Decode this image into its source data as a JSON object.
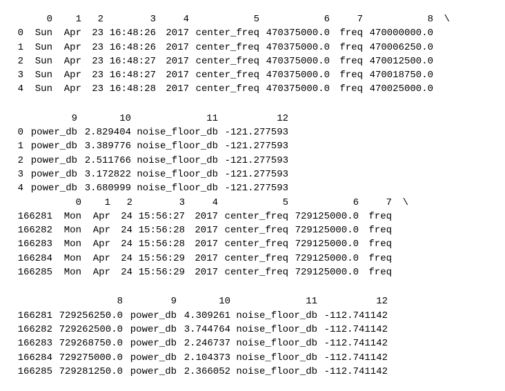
{
  "backslash": "\\",
  "headerA": {
    "idx": "",
    "c0": "0",
    "c1": "1",
    "c2": "2",
    "c3": "3",
    "c4": "4",
    "c5": "5",
    "c6": "6",
    "c7": "7",
    "c8": "8"
  },
  "blockA": [
    {
      "idx": "0",
      "c0": "Sun",
      "c1": "Apr",
      "c2": "23",
      "c3": "16:48:26",
      "c4": "2017",
      "c5": "center_freq",
      "c6": "470375000.0",
      "c7": "freq",
      "c8": "470000000.0"
    },
    {
      "idx": "1",
      "c0": "Sun",
      "c1": "Apr",
      "c2": "23",
      "c3": "16:48:26",
      "c4": "2017",
      "c5": "center_freq",
      "c6": "470375000.0",
      "c7": "freq",
      "c8": "470006250.0"
    },
    {
      "idx": "2",
      "c0": "Sun",
      "c1": "Apr",
      "c2": "23",
      "c3": "16:48:27",
      "c4": "2017",
      "c5": "center_freq",
      "c6": "470375000.0",
      "c7": "freq",
      "c8": "470012500.0"
    },
    {
      "idx": "3",
      "c0": "Sun",
      "c1": "Apr",
      "c2": "23",
      "c3": "16:48:27",
      "c4": "2017",
      "c5": "center_freq",
      "c6": "470375000.0",
      "c7": "freq",
      "c8": "470018750.0"
    },
    {
      "idx": "4",
      "c0": "Sun",
      "c1": "Apr",
      "c2": "23",
      "c3": "16:48:28",
      "c4": "2017",
      "c5": "center_freq",
      "c6": "470375000.0",
      "c7": "freq",
      "c8": "470025000.0"
    }
  ],
  "headerB": {
    "idx": "",
    "c9": "9",
    "c10": "10",
    "c11": "11",
    "c12": "12"
  },
  "blockB": [
    {
      "idx": "0",
      "c9": "power_db",
      "c10": "2.829404",
      "c11": "noise_floor_db",
      "c12": "-121.277593"
    },
    {
      "idx": "1",
      "c9": "power_db",
      "c10": "3.389776",
      "c11": "noise_floor_db",
      "c12": "-121.277593"
    },
    {
      "idx": "2",
      "c9": "power_db",
      "c10": "2.511766",
      "c11": "noise_floor_db",
      "c12": "-121.277593"
    },
    {
      "idx": "3",
      "c9": "power_db",
      "c10": "3.172822",
      "c11": "noise_floor_db",
      "c12": "-121.277593"
    },
    {
      "idx": "4",
      "c9": "power_db",
      "c10": "3.680999",
      "c11": "noise_floor_db",
      "c12": "-121.277593"
    }
  ],
  "headerC": {
    "idx": "",
    "c0": "0",
    "c1": "1",
    "c2": "2",
    "c3": "3",
    "c4": "4",
    "c5": "5",
    "c6": "6",
    "c7": "7"
  },
  "blockC": [
    {
      "idx": "166281",
      "c0": "Mon",
      "c1": "Apr",
      "c2": "24",
      "c3": "15:56:27",
      "c4": "2017",
      "c5": "center_freq",
      "c6": "729125000.0",
      "c7": "freq"
    },
    {
      "idx": "166282",
      "c0": "Mon",
      "c1": "Apr",
      "c2": "24",
      "c3": "15:56:28",
      "c4": "2017",
      "c5": "center_freq",
      "c6": "729125000.0",
      "c7": "freq"
    },
    {
      "idx": "166283",
      "c0": "Mon",
      "c1": "Apr",
      "c2": "24",
      "c3": "15:56:28",
      "c4": "2017",
      "c5": "center_freq",
      "c6": "729125000.0",
      "c7": "freq"
    },
    {
      "idx": "166284",
      "c0": "Mon",
      "c1": "Apr",
      "c2": "24",
      "c3": "15:56:29",
      "c4": "2017",
      "c5": "center_freq",
      "c6": "729125000.0",
      "c7": "freq"
    },
    {
      "idx": "166285",
      "c0": "Mon",
      "c1": "Apr",
      "c2": "24",
      "c3": "15:56:29",
      "c4": "2017",
      "c5": "center_freq",
      "c6": "729125000.0",
      "c7": "freq"
    }
  ],
  "headerD": {
    "idx": "",
    "c8": "8",
    "c9": "9",
    "c10": "10",
    "c11": "11",
    "c12": "12"
  },
  "blockD": [
    {
      "idx": "166281",
      "c8": "729256250.0",
      "c9": "power_db",
      "c10": "4.309261",
      "c11": "noise_floor_db",
      "c12": "-112.741142"
    },
    {
      "idx": "166282",
      "c8": "729262500.0",
      "c9": "power_db",
      "c10": "3.744764",
      "c11": "noise_floor_db",
      "c12": "-112.741142"
    },
    {
      "idx": "166283",
      "c8": "729268750.0",
      "c9": "power_db",
      "c10": "2.246737",
      "c11": "noise_floor_db",
      "c12": "-112.741142"
    },
    {
      "idx": "166284",
      "c8": "729275000.0",
      "c9": "power_db",
      "c10": "2.104373",
      "c11": "noise_floor_db",
      "c12": "-112.741142"
    },
    {
      "idx": "166285",
      "c8": "729281250.0",
      "c9": "power_db",
      "c10": "2.366052",
      "c11": "noise_floor_db",
      "c12": "-112.741142"
    }
  ]
}
